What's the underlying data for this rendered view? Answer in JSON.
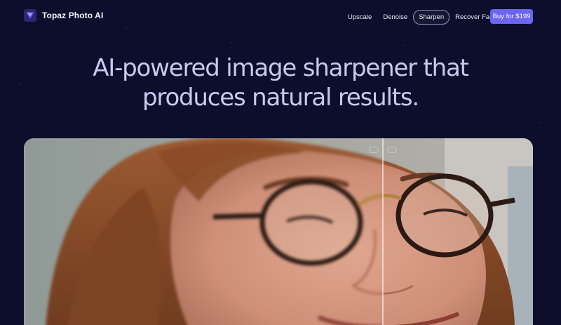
{
  "nav": {
    "brand_name": "Topaz Photo AI",
    "links": [
      {
        "label": "Upscale"
      },
      {
        "label": "Denoise"
      },
      {
        "label": "Sharpen",
        "active": true
      },
      {
        "label": "Recover Faces"
      }
    ],
    "buy_label": "Buy for $199"
  },
  "hero": {
    "headline_line1": "AI-powered image sharpener that",
    "headline_line2": "produces natural results."
  },
  "colors": {
    "background": "#0d0e2c",
    "accent": "#6c64f2",
    "headline": "#c9c9f0"
  },
  "comparison": {
    "left_label": "blurred original",
    "right_label": "sharpened result"
  }
}
